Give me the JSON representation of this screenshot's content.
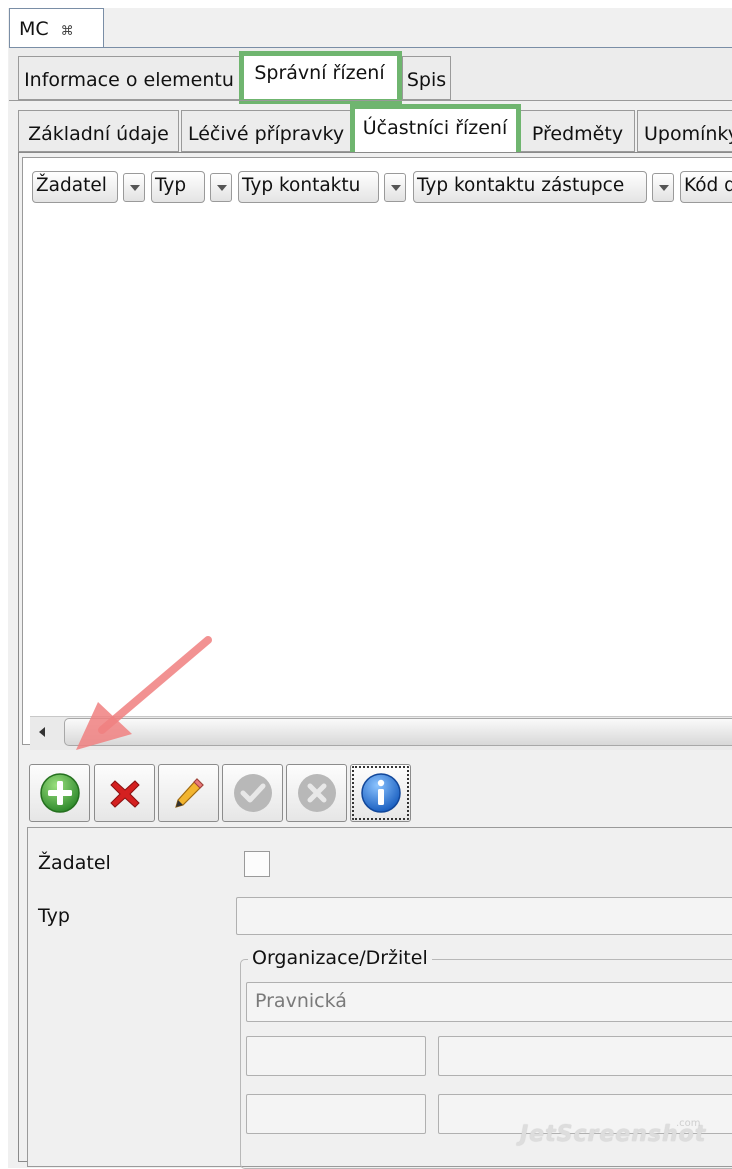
{
  "view_tab": {
    "label": "MC",
    "close_glyph": "⌘"
  },
  "main_tabs": [
    {
      "label": "Informace o elementu"
    },
    {
      "label": "Správní řízení"
    },
    {
      "label": "Spis"
    }
  ],
  "sub_tabs": [
    {
      "label": "Základní údaje"
    },
    {
      "label": "Léčivé přípravky"
    },
    {
      "label": "Účastníci řízení"
    },
    {
      "label": "Předměty"
    },
    {
      "label": "Upomínky"
    }
  ],
  "table": {
    "columns": [
      {
        "label": "Žadatel"
      },
      {
        "label": "Typ"
      },
      {
        "label": "Typ kontaktu"
      },
      {
        "label": "Typ kontaktu zástupce"
      },
      {
        "label": "Kód d"
      }
    ]
  },
  "toolbar": {
    "buttons": [
      {
        "icon": "add-icon",
        "enabled": true
      },
      {
        "icon": "delete-icon",
        "enabled": true
      },
      {
        "icon": "edit-pencil-icon",
        "enabled": true
      },
      {
        "icon": "confirm-icon",
        "enabled": false
      },
      {
        "icon": "cancel-icon",
        "enabled": false
      },
      {
        "icon": "info-icon",
        "enabled": true
      }
    ]
  },
  "form": {
    "zadatel_label": "Žadatel",
    "typ_label": "Typ",
    "typ_value": "",
    "organization_group": {
      "legend": "Organizace/Držitel",
      "type_value": "Pravnická"
    }
  },
  "watermark": {
    "text": "JetScreenshot",
    "suffix": ".com"
  },
  "colors": {
    "highlight": "#6fb56f",
    "arrow": "#f08080",
    "add_green": "#3f9a3a",
    "delete_red": "#d42020",
    "info_blue": "#1f6fd0"
  }
}
